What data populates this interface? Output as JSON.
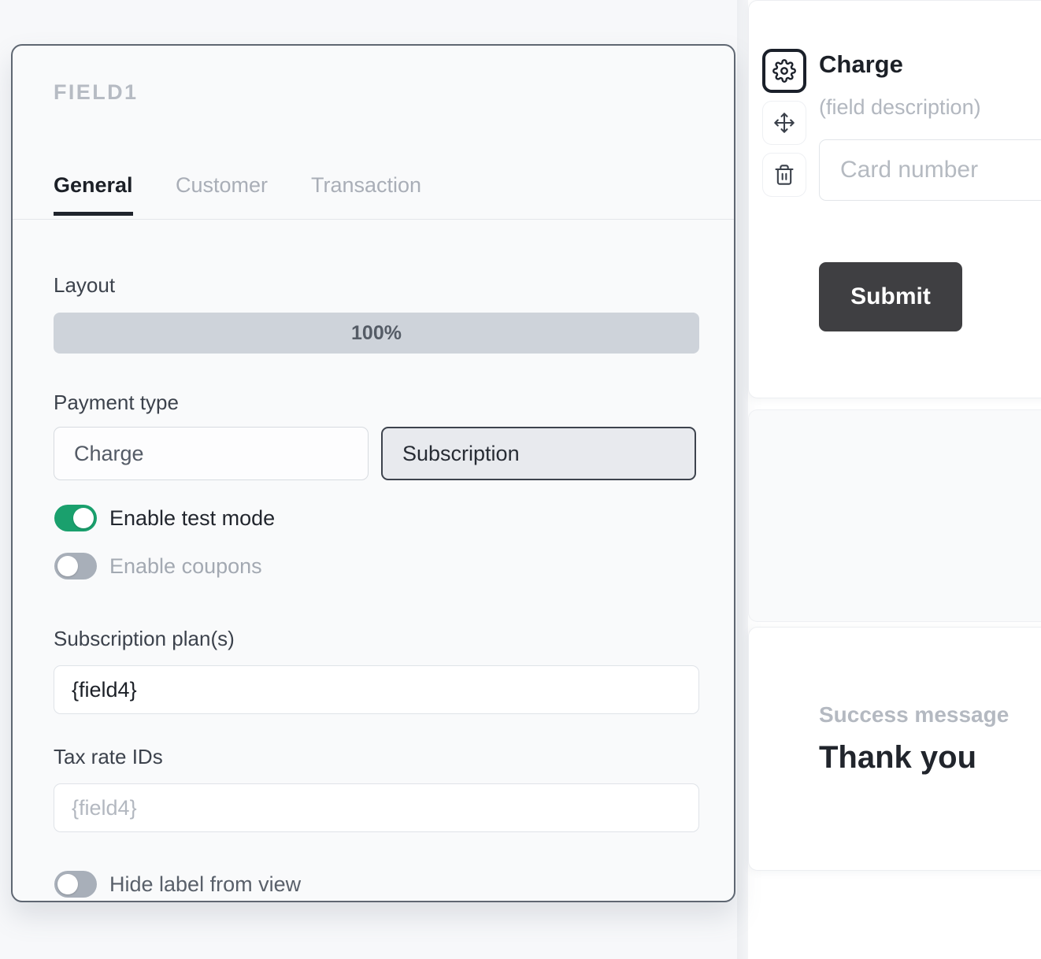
{
  "settings_panel": {
    "field_eyebrow": "FIELD1",
    "tabs": [
      {
        "label": "General",
        "active": true
      },
      {
        "label": "Customer",
        "active": false
      },
      {
        "label": "Transaction",
        "active": false
      }
    ],
    "layout": {
      "label": "Layout",
      "value": "100%"
    },
    "payment_type": {
      "label": "Payment type",
      "options": [
        {
          "label": "Charge",
          "selected": false
        },
        {
          "label": "Subscription",
          "selected": true
        }
      ]
    },
    "toggles": [
      {
        "label": "Enable test mode",
        "state": "on",
        "accent": "#1aa06d"
      },
      {
        "label": "Enable coupons",
        "state": "off",
        "accent": "#a8afb9"
      }
    ],
    "subscription_plans": {
      "label": "Subscription plan(s)",
      "value": "{field4}"
    },
    "tax_rate_ids": {
      "label": "Tax rate IDs",
      "placeholder": "{field4}"
    },
    "hide_label_toggle": {
      "label": "Hide label from view",
      "state": "off"
    }
  },
  "field_toolbar": {
    "buttons": [
      {
        "icon": "gear-icon",
        "active": true
      },
      {
        "icon": "move-icon",
        "active": false
      },
      {
        "icon": "trash-icon",
        "active": false
      }
    ]
  },
  "preview": {
    "charge_card": {
      "title": "Charge",
      "description": "(field description)",
      "card_number_placeholder": "Card number",
      "submit_label": "Submit",
      "submit_color": "#3f3f42"
    },
    "success_card": {
      "eyebrow": "Success message",
      "heading": "Thank you"
    }
  }
}
